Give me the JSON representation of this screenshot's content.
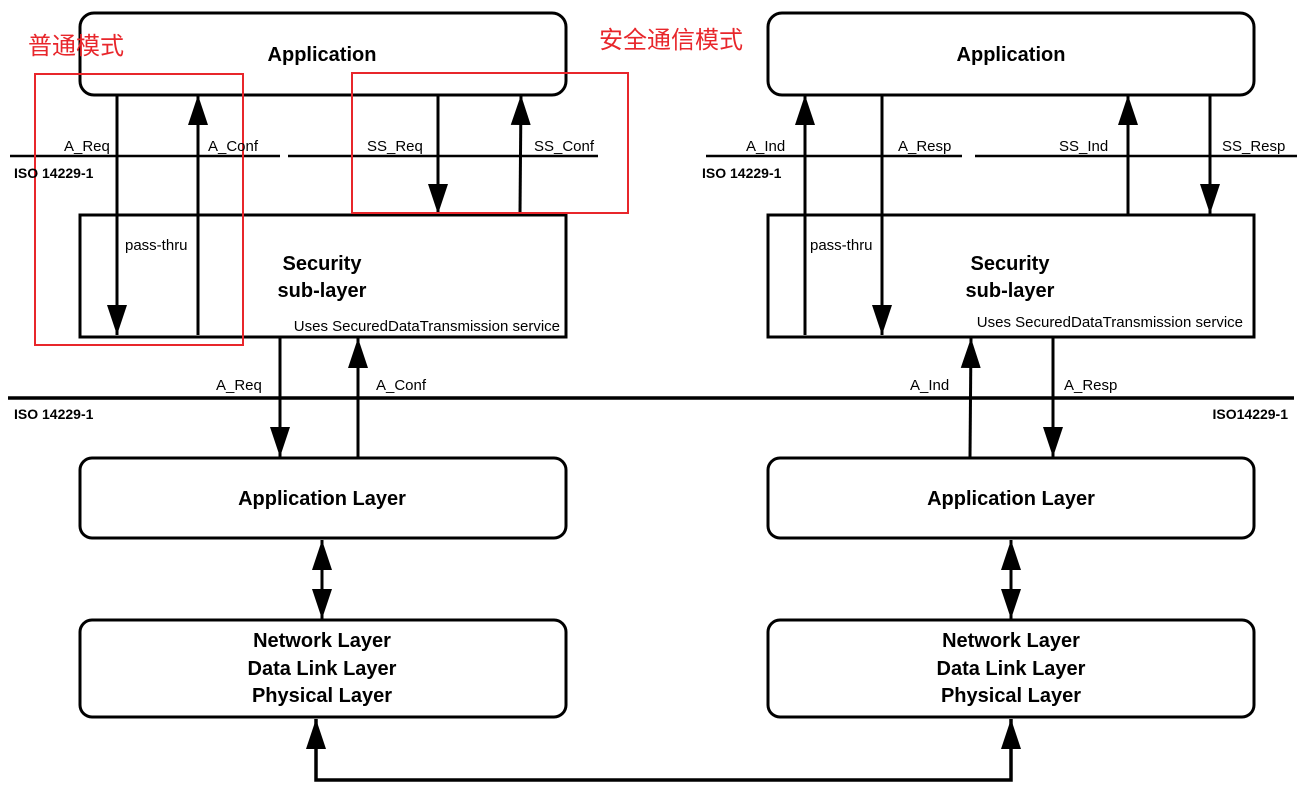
{
  "annotations": {
    "normal_mode": "普通模式",
    "secure_mode": "安全通信模式",
    "highlight_color": "#e8262b"
  },
  "left": {
    "application": "Application",
    "a_req_top": "A_Req",
    "a_conf_top": "A_Conf",
    "ss_req": "SS_Req",
    "ss_conf": "SS_Conf",
    "iso_top": "ISO 14229-1",
    "pass_thru": "pass-thru",
    "security_line1": "Security",
    "security_line2": "sub-layer",
    "security_note": "Uses SecuredDataTransmission service",
    "a_req_bottom": "A_Req",
    "a_conf_bottom": "A_Conf",
    "iso_main": "ISO 14229-1",
    "application_layer": "Application Layer",
    "lower_layers": [
      "Network Layer",
      "Data Link Layer",
      "Physical Layer"
    ]
  },
  "right": {
    "application": "Application",
    "a_ind_top": "A_Ind",
    "a_resp_top": "A_Resp",
    "ss_ind": "SS_Ind",
    "ss_resp": "SS_Resp",
    "iso_top": "ISO 14229-1",
    "pass_thru": "pass-thru",
    "security_line1": "Security",
    "security_line2": "sub-layer",
    "security_note": "Uses SecuredDataTransmission service",
    "a_ind_bottom": "A_Ind",
    "a_resp_bottom": "A_Resp",
    "iso_main": "ISO14229-1",
    "application_layer": "Application Layer",
    "lower_layers": [
      "Network Layer",
      "Data Link Layer",
      "Physical Layer"
    ]
  }
}
